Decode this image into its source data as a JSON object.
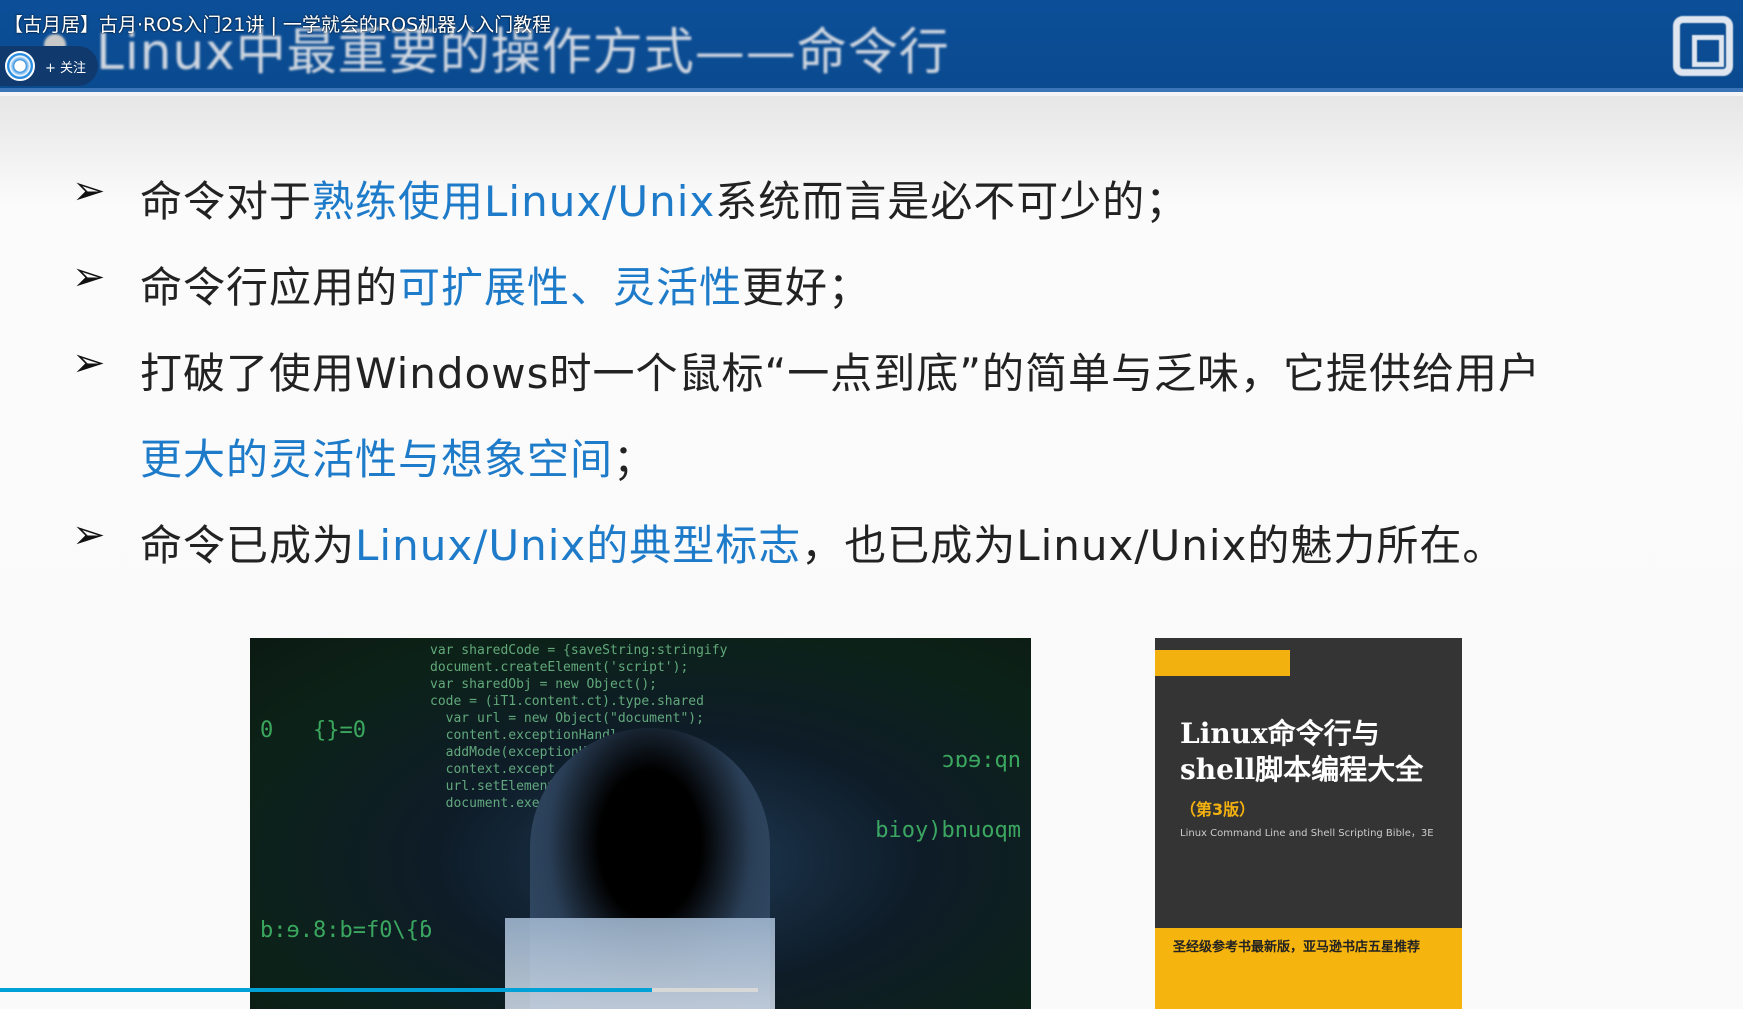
{
  "video": {
    "title": "【古月居】古月·ROS入门21讲 | 一学就会的ROS机器人入门教程",
    "follow_label": "+ 关注",
    "progress_fraction": 0.374
  },
  "slide": {
    "title": "Linux中最重要的操作方式——命令行",
    "bullets": [
      {
        "parts": [
          "命令对于",
          "熟练使用Linux/Unix",
          "系统而言是必不可少的；"
        ]
      },
      {
        "parts": [
          "命令行应用的",
          "可扩展性、灵活性",
          "更好；"
        ]
      },
      {
        "parts": [
          "打破了使用Windows时一个鼠标“一点到底”的简单与乏味，它提供给用户"
        ],
        "cont": [
          "更大的灵活性与想象空间",
          "；"
        ]
      },
      {
        "parts": [
          "命令已成为",
          "Linux/Unix的典型标志",
          "，也已成为Linux/Unix的魅力所在。"
        ]
      }
    ],
    "book": {
      "title1": "Linux命令行与",
      "title2": "shell脚本编程大全",
      "edition": "（第3版）",
      "english": "Linux Command Line and Shell Scripting Bible，3E",
      "tagline": "圣经级参考书最新版，亚马逊书店五星推荐"
    }
  },
  "colors": {
    "header": "#0c4f98",
    "accent": "#1e7bc9",
    "progress": "#00a1d6"
  }
}
